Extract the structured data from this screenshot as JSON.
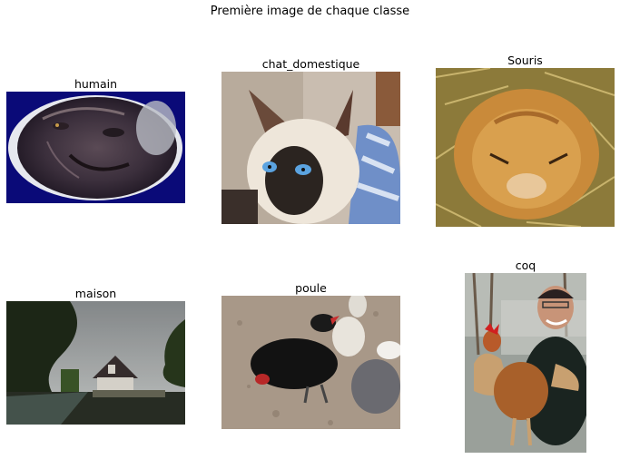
{
  "figure": {
    "title": "Première image de chaque classe",
    "panels": [
      {
        "title": "humain",
        "image": "photo-human-face-oval-vignette"
      },
      {
        "title": "chat_domestique",
        "image": "photo-siamese-cat"
      },
      {
        "title": "Souris",
        "image": "photo-sleeping-dormouse"
      },
      {
        "title": "maison",
        "image": "photo-house-by-river"
      },
      {
        "title": "poule",
        "image": "photo-black-hen"
      },
      {
        "title": "coq",
        "image": "photo-man-holding-rooster"
      }
    ]
  }
}
